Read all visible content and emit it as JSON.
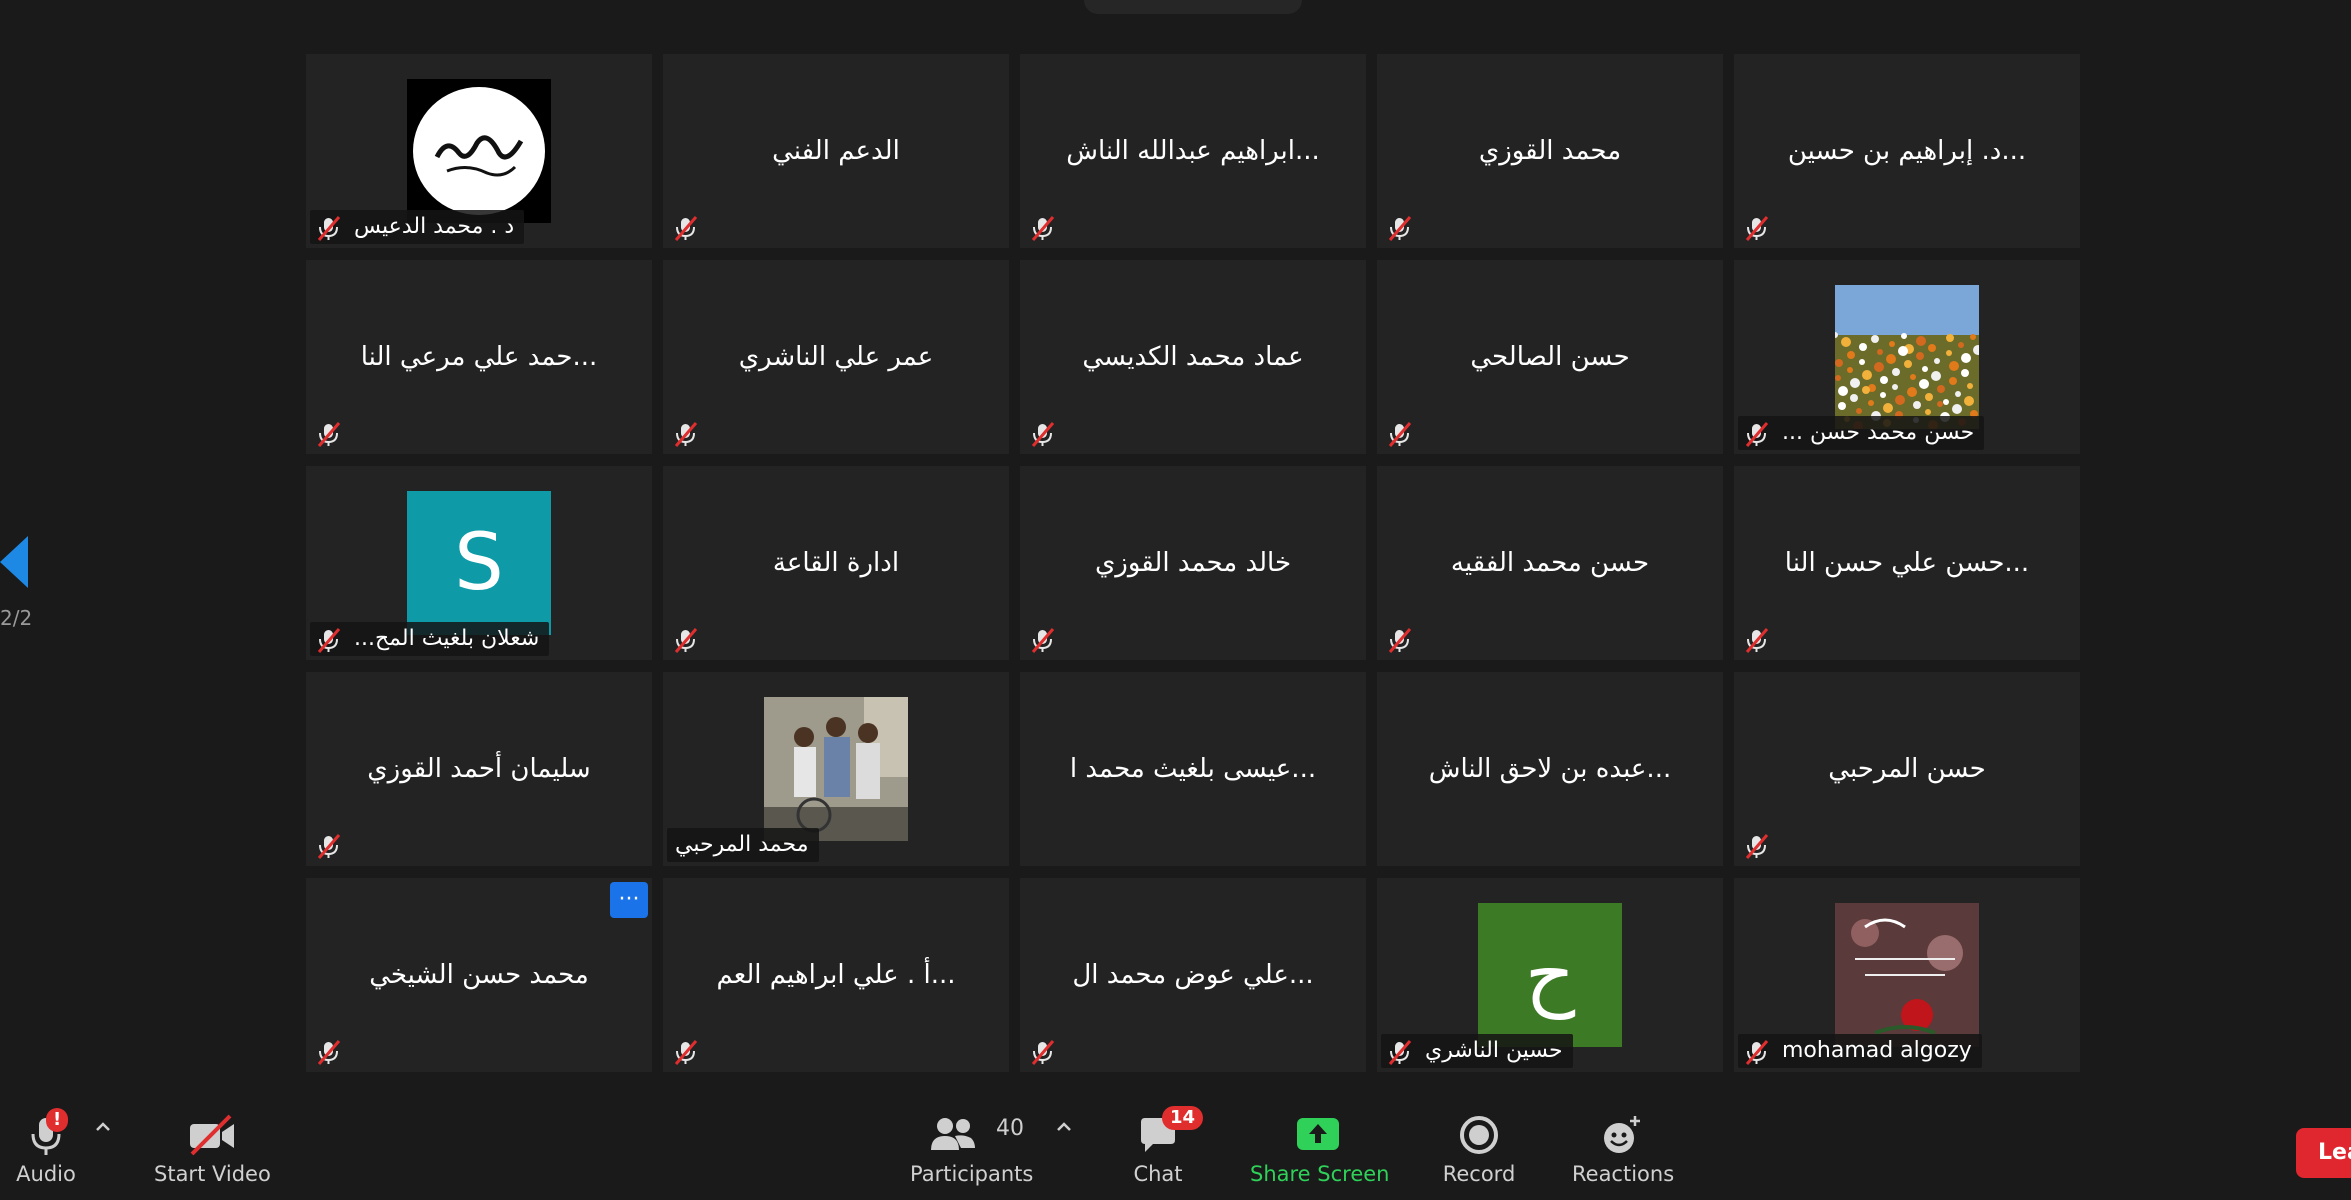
{
  "page": {
    "indicator": "2/2"
  },
  "tiles": [
    {
      "name": "د . محمد  الدعيس",
      "muted": true,
      "avatar": "calligraphy"
    },
    {
      "name": "الدعم الفني",
      "muted": true
    },
    {
      "name": "...ابراهيم عبدالله  الناش",
      "muted": true
    },
    {
      "name": "محمد القوزي",
      "muted": true
    },
    {
      "name": "...د. إبراهيم بن حسين",
      "muted": true
    },
    {
      "name": "...حمد علي مرعي النا",
      "muted": true
    },
    {
      "name": "عمر علي الناشري",
      "muted": true
    },
    {
      "name": "عماد  محمد الكديسي",
      "muted": true
    },
    {
      "name": "حسن الصالحي",
      "muted": true
    },
    {
      "name": "... حسن محمد حسن",
      "muted": true,
      "avatar": "flowers"
    },
    {
      "name": "...شعلان بلغيث المح",
      "muted": true,
      "avatar": "letter",
      "letter": "S",
      "color": "#0e9aa7"
    },
    {
      "name": "ادارة القاعة",
      "muted": true
    },
    {
      "name": "خالد محمد القوزي",
      "muted": true
    },
    {
      "name": "حسن محمد الفقيه",
      "muted": true
    },
    {
      "name": "...حسن علي حسن النا",
      "muted": true
    },
    {
      "name": "سليمان أحمد القوزي",
      "muted": true
    },
    {
      "name": "محمد المرحبي",
      "muted": false,
      "avatar": "photo"
    },
    {
      "name": "...عيسى بلغيث محمد ا",
      "muted": false
    },
    {
      "name": "...عبده بن لاحق الناش",
      "muted": false
    },
    {
      "name": "حسن المرحبي",
      "muted": true
    },
    {
      "name": "محمد حسن الشيخي",
      "muted": true,
      "more": "···"
    },
    {
      "name": "...أ . علي ابراهيم العم",
      "muted": true
    },
    {
      "name": "...علي عوض محمد ال",
      "muted": true
    },
    {
      "name": "حسين الناشري",
      "muted": true,
      "avatar": "letter",
      "letter": "ح",
      "color": "#3d7a25"
    },
    {
      "name": "mohamad algozy",
      "muted": true,
      "avatar": "rose"
    }
  ],
  "toolbar": {
    "audio": {
      "label": "Audio",
      "badge": "!"
    },
    "video": {
      "label": "Start Video"
    },
    "participants": {
      "label": "Participants",
      "count": "40"
    },
    "chat": {
      "label": "Chat",
      "badge": "14"
    },
    "share": {
      "label": "Share Screen"
    },
    "record": {
      "label": "Record"
    },
    "reactions": {
      "label": "Reactions"
    },
    "leave": {
      "label": "Lea"
    }
  },
  "colors": {
    "tile": "#232323",
    "background": "#1a1a1a",
    "share_green": "#2fd159",
    "badge_red": "#e02e2e",
    "more_blue": "#1a73e8"
  }
}
